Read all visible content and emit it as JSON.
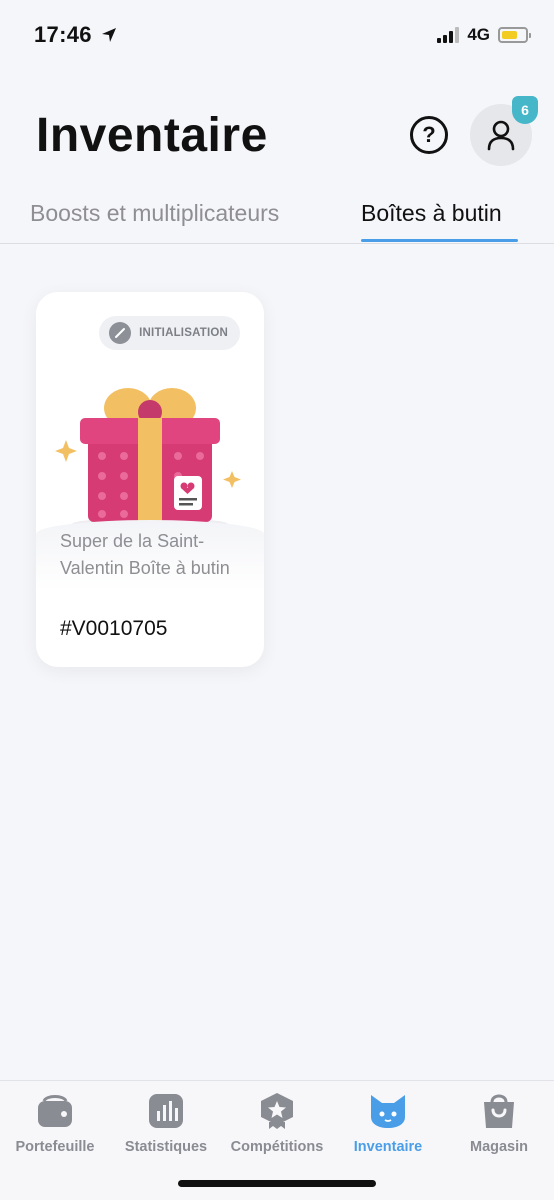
{
  "status_bar": {
    "time": "17:46",
    "network": "4G"
  },
  "header": {
    "title": "Inventaire",
    "help_label": "?",
    "notification_count": "6"
  },
  "tabs": [
    {
      "label": "Boosts et multiplicateurs",
      "active": false
    },
    {
      "label": "Boîtes à butin",
      "active": true
    }
  ],
  "loot_boxes": [
    {
      "status": "INITIALISATION",
      "name": "Super de la Saint-Valentin Boîte à butin",
      "code": "#V0010705"
    }
  ],
  "nav": [
    {
      "label": "Portefeuille",
      "icon": "wallet-icon",
      "active": false
    },
    {
      "label": "Statistiques",
      "icon": "stats-icon",
      "active": false
    },
    {
      "label": "Compétitions",
      "icon": "trophy-icon",
      "active": false
    },
    {
      "label": "Inventaire",
      "icon": "cat-icon",
      "active": true
    },
    {
      "label": "Magasin",
      "icon": "shopping-bag-icon",
      "active": false
    }
  ],
  "colors": {
    "accent": "#4a9ee8",
    "badge": "#46b6c9",
    "gift_pink": "#e0457f",
    "gift_gold": "#f2c062"
  }
}
